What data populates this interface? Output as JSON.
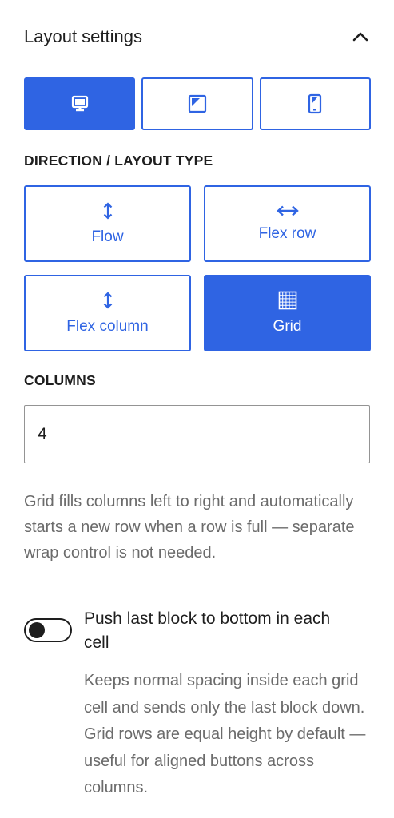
{
  "panel": {
    "title": "Layout settings"
  },
  "devices": [
    {
      "name": "desktop",
      "active": true
    },
    {
      "name": "tablet",
      "active": false
    },
    {
      "name": "mobile",
      "active": false
    }
  ],
  "direction": {
    "label": "DIRECTION / LAYOUT TYPE",
    "options": [
      {
        "label": "Flow",
        "icon": "vertical-arrows-icon",
        "active": false
      },
      {
        "label": "Flex row",
        "icon": "horizontal-arrows-icon",
        "active": false
      },
      {
        "label": "Flex column",
        "icon": "vertical-arrows-icon",
        "active": false
      },
      {
        "label": "Grid",
        "icon": "grid-icon",
        "active": true
      }
    ]
  },
  "columns": {
    "label": "COLUMNS",
    "value": "4",
    "help": "Grid fills columns left to right and automatically starts a new row when a row is full — separate wrap control is not needed."
  },
  "push_last": {
    "label": "Push last block to bottom in each cell",
    "checked": false,
    "help": "Keeps normal spacing inside each grid cell and sends only the last block down. Grid rows are equal height by default — useful for aligned buttons across columns."
  },
  "colors": {
    "accent": "#2f64e3",
    "text": "#1e1e1e",
    "muted": "#6b6b6b",
    "border": "#949494"
  }
}
